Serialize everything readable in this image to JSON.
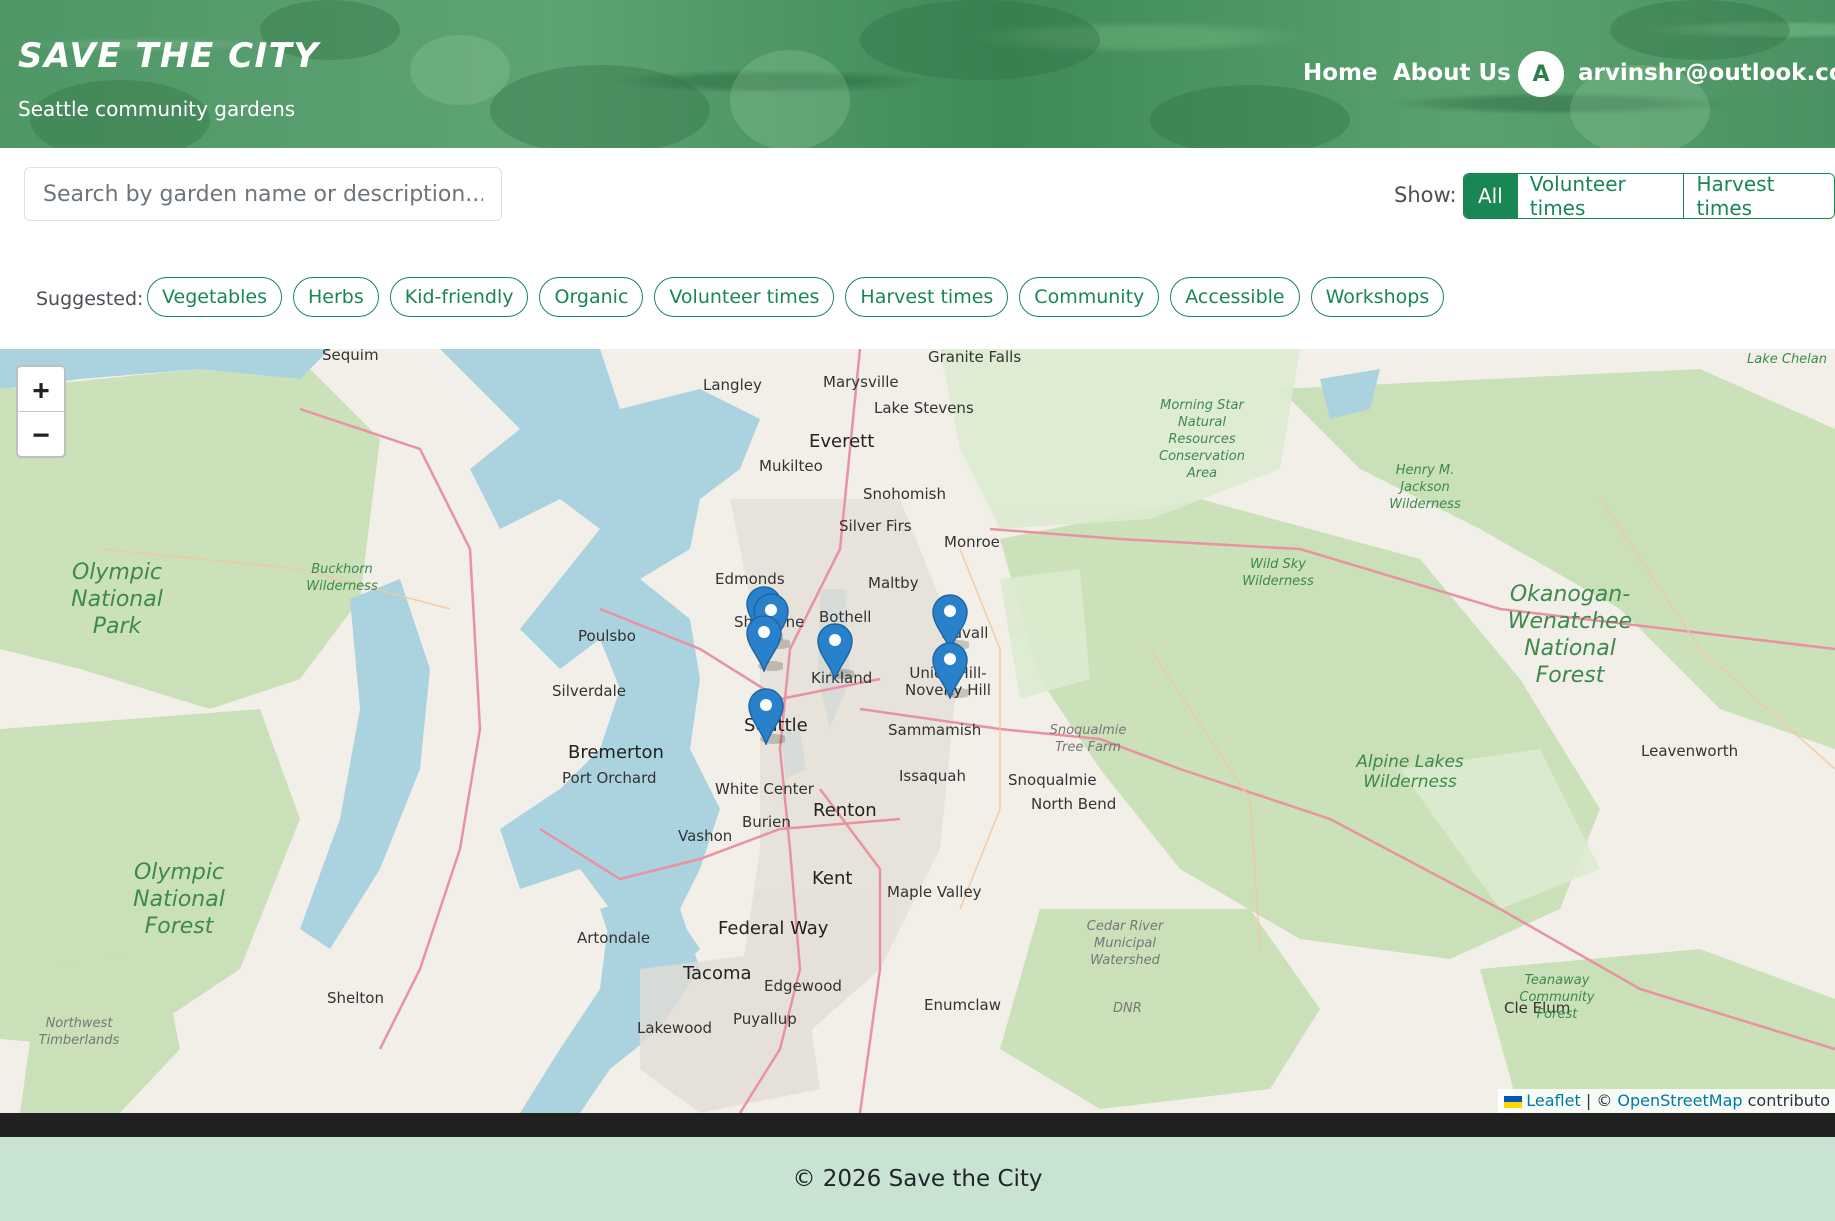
{
  "header": {
    "brand": "Save the City",
    "tagline": "Seattle community gardens",
    "nav": {
      "home": "Home",
      "about": "About Us"
    },
    "user": {
      "avatar_initial": "A",
      "email": "arvinshr@outlook.com"
    }
  },
  "search": {
    "placeholder": "Search by garden name or description..."
  },
  "filter": {
    "label": "Show:",
    "options": [
      "All",
      "Volunteer times",
      "Harvest times"
    ],
    "selected": "All"
  },
  "suggested": {
    "label": "Suggested:",
    "chips": [
      "Vegetables",
      "Herbs",
      "Kid-friendly",
      "Organic",
      "Volunteer times",
      "Harvest times",
      "Community",
      "Accessible",
      "Workshops"
    ]
  },
  "map": {
    "zoom_in": "+",
    "zoom_out": "−",
    "places": [
      "Sequim",
      "Granite Falls",
      "Lake Chelan",
      "Langley",
      "Marysville",
      "Lake Stevens",
      "Everett",
      "Mukilteo",
      "Snohomish",
      "Silver Firs",
      "Monroe",
      "Edmonds",
      "Maltby",
      "Shoreline",
      "Bothell",
      "Duvall",
      "Poulsbo",
      "Silverdale",
      "Kirkland",
      "Union Hill-Novelty Hill",
      "Seattle",
      "Sammamish",
      "Bremerton",
      "Port Orchard",
      "White Center",
      "Issaquah",
      "Snoqualmie",
      "Renton",
      "North Bend",
      "Burien",
      "Vashon",
      "Kent",
      "Maple Valley",
      "Federal Way",
      "Artondale",
      "Tacoma",
      "Edgewood",
      "Enumclaw",
      "Shelton",
      "Puyallup",
      "Lakewood",
      "Cle Elum",
      "Leavenworth"
    ],
    "parks": [
      "Olympic National Park",
      "Olympic National Forest",
      "Buckhorn Wilderness",
      "Okanogan-Wenatchee National Forest",
      "Alpine Lakes Wilderness",
      "Morning Star Natural Resources Conservation Area",
      "Henry M. Jackson Wilderness",
      "Wild Sky Wilderness",
      "Snoqualmie Tree Farm",
      "Cedar River Municipal Watershed",
      "Teanaway Community Forest",
      "DNR",
      "Northwest Timberlands"
    ],
    "marker_count": 7,
    "attribution": {
      "leaflet": "Leaflet",
      "sep": " | © ",
      "osm": "OpenStreetMap",
      "rest": " contributo"
    }
  },
  "footer": {
    "text": "© 2026 Save the City"
  }
}
